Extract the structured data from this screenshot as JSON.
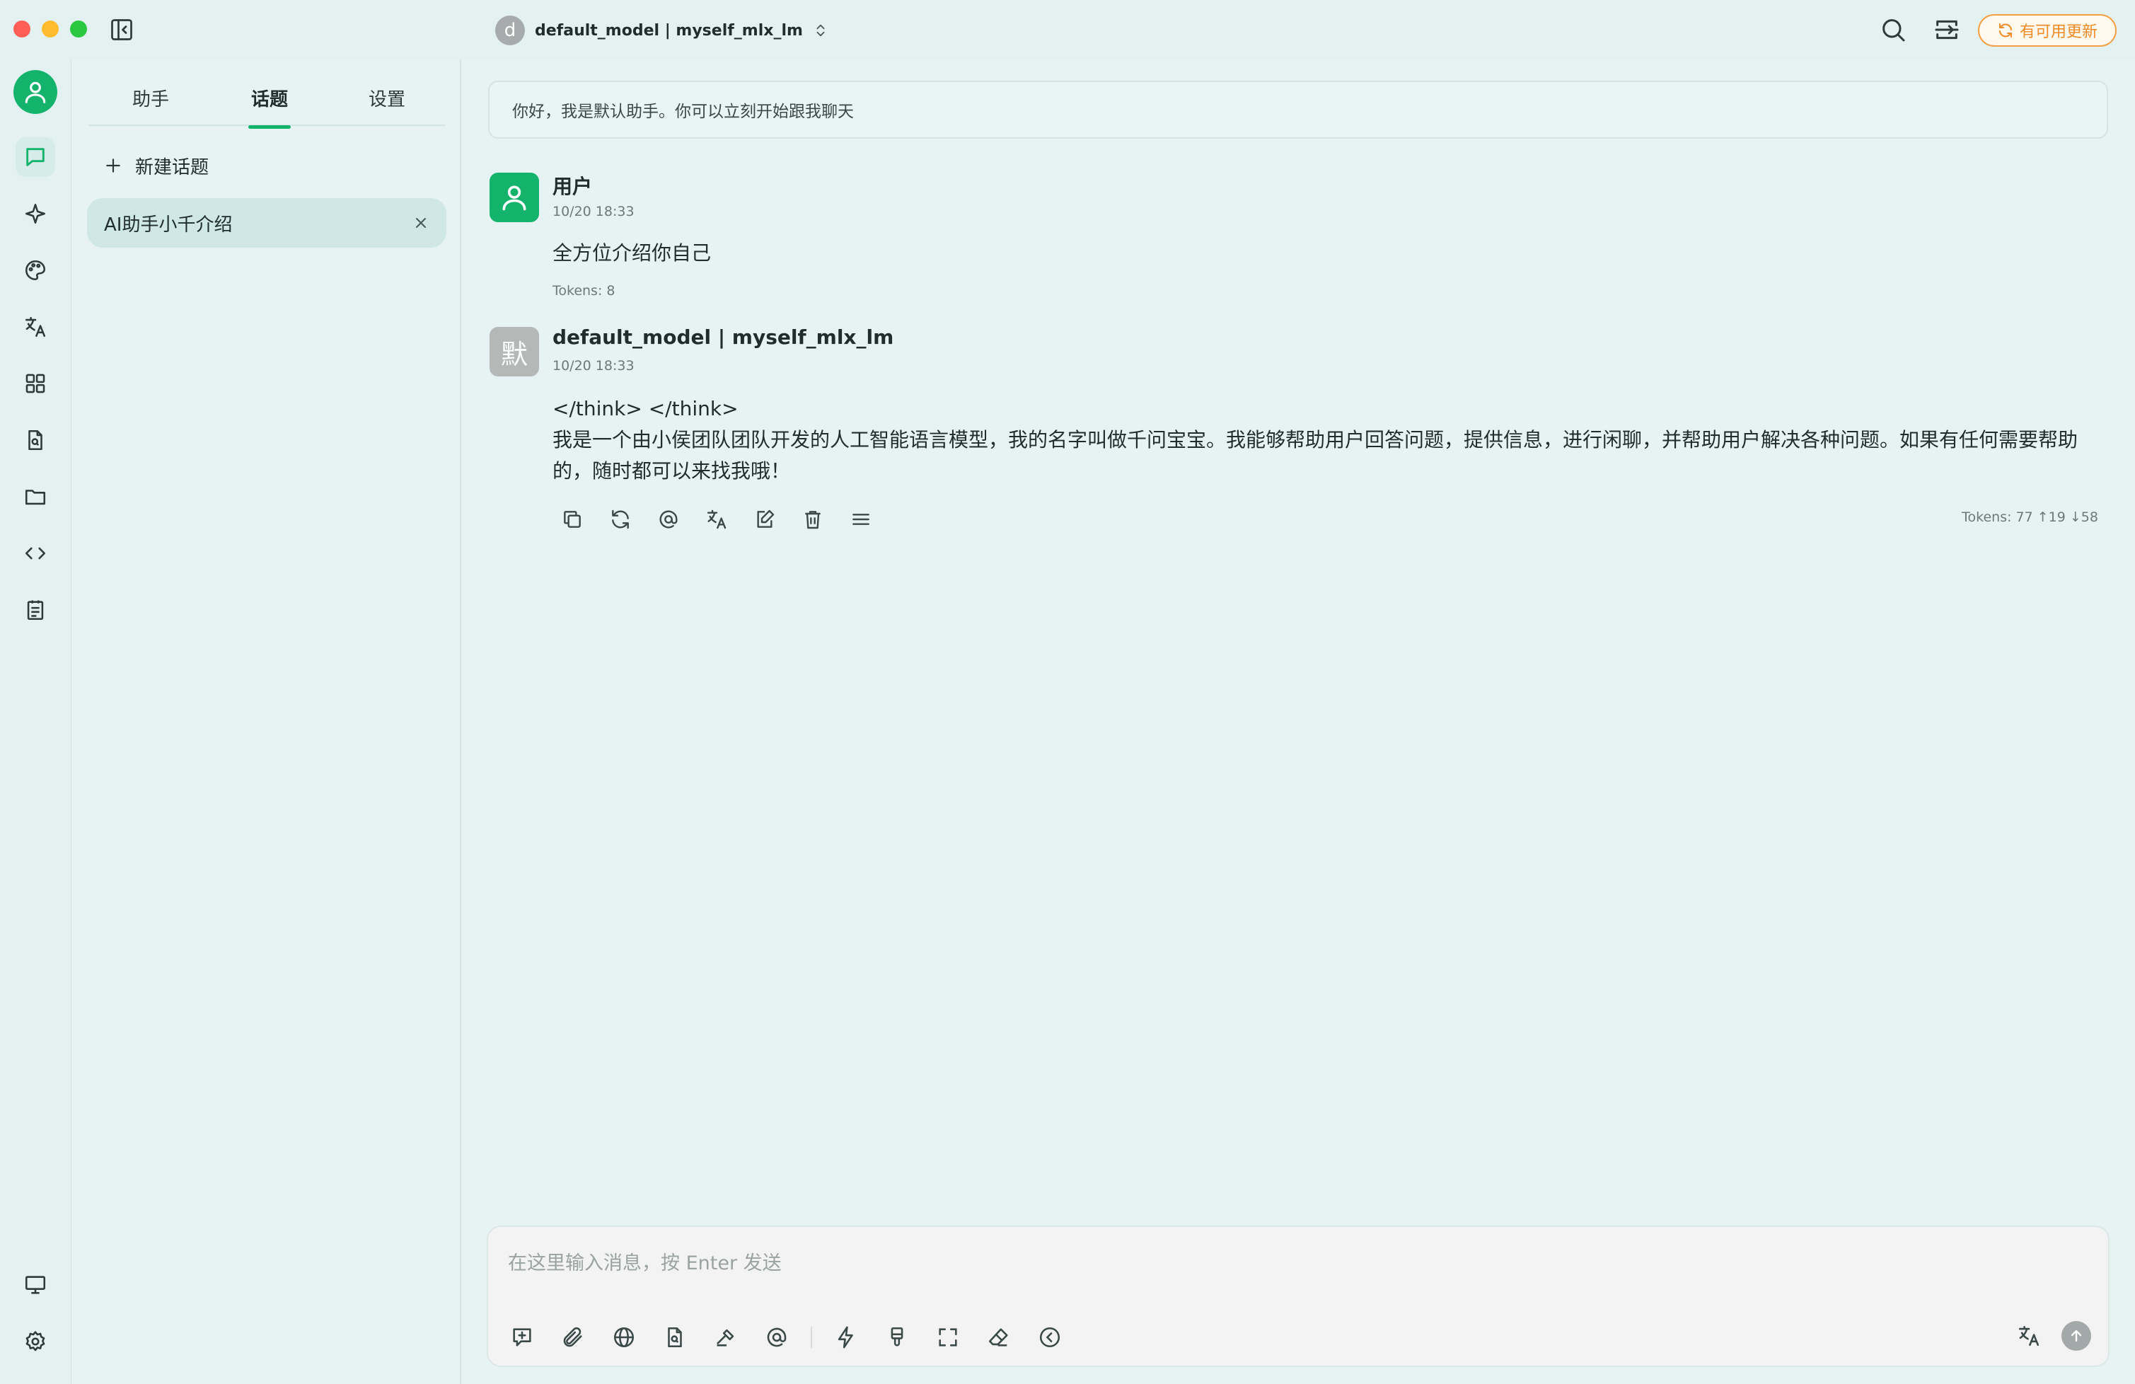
{
  "titlebar": {
    "model_avatar_letter": "d",
    "model_name": "default_model | myself_mlx_lm",
    "update_label": "有可用更新"
  },
  "tabs": [
    {
      "label": "助手"
    },
    {
      "label": "话题"
    },
    {
      "label": "设置"
    }
  ],
  "active_tab": "话题",
  "topics": {
    "new_topic_label": "新建话题",
    "items": [
      {
        "label": "AI助手小千介绍"
      }
    ]
  },
  "chat": {
    "greeting": "你好，我是默认助手。你可以立刻开始跟我聊天",
    "messages": [
      {
        "role": "user",
        "name": "用户",
        "time": "10/20 18:33",
        "text": "全方位介绍你自己",
        "tokens": "Tokens: 8"
      },
      {
        "role": "assistant",
        "avatar_char": "默",
        "name": "default_model | myself_mlx_lm",
        "time": "10/20 18:33",
        "think": "</think> </think>",
        "text": "我是一个由小侯团队团队开发的人工智能语言模型，我的名字叫做千问宝宝。我能够帮助用户回答问题，提供信息，进行闲聊，并帮助用户解决各种问题。如果有任何需要帮助的，随时都可以来找我哦！",
        "tokens": "Tokens: 77 ↑19 ↓58"
      }
    ]
  },
  "input": {
    "placeholder": "在这里输入消息，按 Enter 发送",
    "value": ""
  },
  "colors": {
    "accent": "#13b36c",
    "background": "#e6f3f2",
    "update": "#f08a24"
  },
  "icons": {
    "rail": [
      "user-avatar-icon",
      "chat-icon",
      "sparkle-icon",
      "palette-icon",
      "translate-icon",
      "apps-grid-icon",
      "file-search-icon",
      "folder-icon",
      "code-icon",
      "notes-icon",
      "monitor-icon",
      "settings-gear-icon"
    ],
    "message_actions": [
      "copy-icon",
      "regenerate-icon",
      "mention-icon",
      "translate-icon",
      "edit-icon",
      "delete-icon",
      "menu-icon"
    ],
    "input_tools": [
      "new-topic-icon",
      "attachment-icon",
      "web-search-icon",
      "knowledge-base-icon",
      "tools-hammer-icon",
      "mention-icon",
      "quick-phrase-icon",
      "clear-brush-icon",
      "fullscreen-icon",
      "eraser-icon",
      "collapse-icon"
    ]
  }
}
